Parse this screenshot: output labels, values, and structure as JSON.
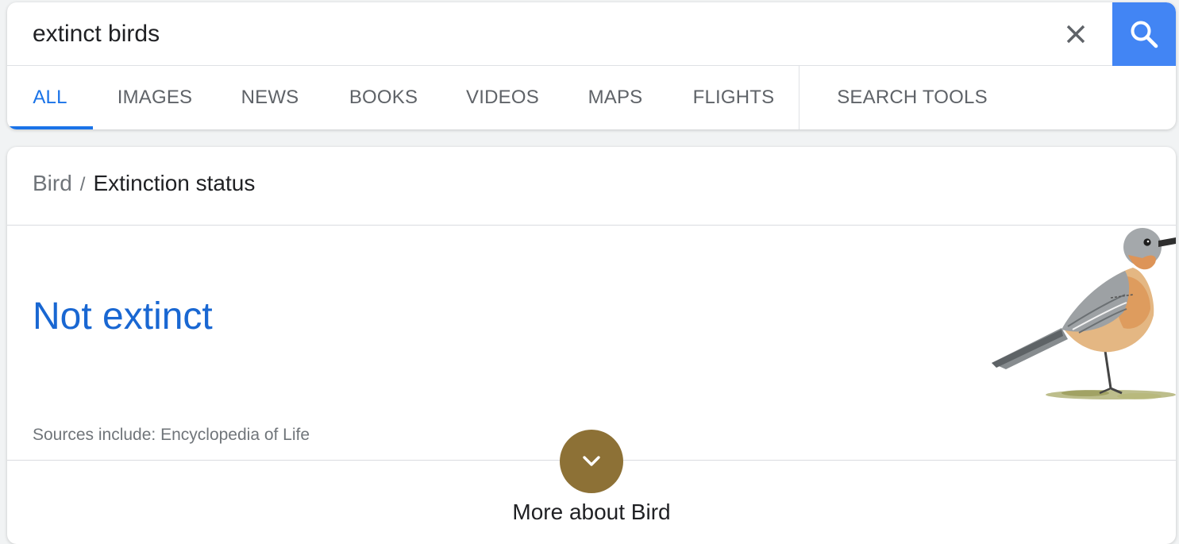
{
  "search": {
    "query": "extinct birds",
    "clear_icon": "close-icon",
    "search_icon": "search-icon",
    "accent_color": "#4285f4"
  },
  "tabs": [
    {
      "label": "ALL",
      "active": true
    },
    {
      "label": "IMAGES",
      "active": false
    },
    {
      "label": "NEWS",
      "active": false
    },
    {
      "label": "BOOKS",
      "active": false
    },
    {
      "label": "VIDEOS",
      "active": false
    },
    {
      "label": "MAPS",
      "active": false
    },
    {
      "label": "FLIGHTS",
      "active": false
    }
  ],
  "search_tools": {
    "label": "SEARCH TOOLS"
  },
  "result": {
    "breadcrumb": {
      "parent": "Bird",
      "separator": "/",
      "current": "Extinction status"
    },
    "answer": "Not extinct",
    "answer_color": "#1967d2",
    "sources": "Sources include: Encyclopedia of Life",
    "image": "bird-illustration",
    "expand_icon": "chevron-down-icon",
    "expand_color": "#8d7136",
    "more_label": "More about Bird"
  }
}
